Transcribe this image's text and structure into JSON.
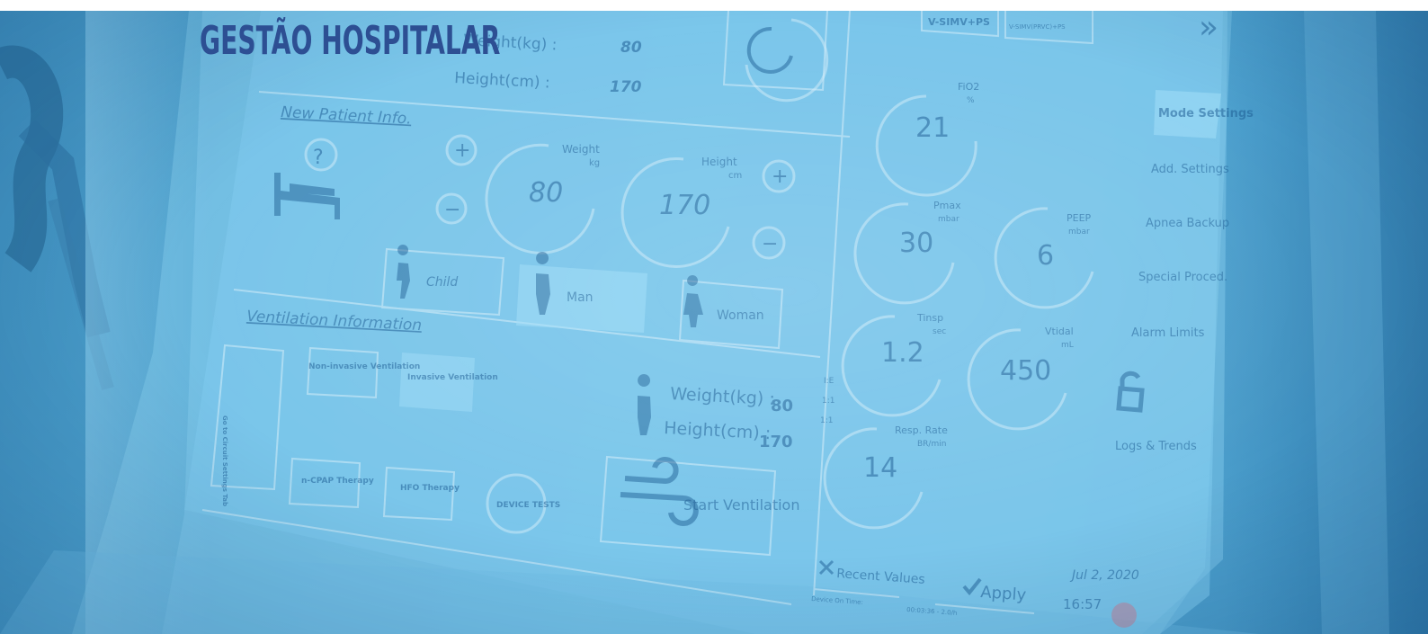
{
  "header": {
    "title": "GESTÃO HOSPITALAR"
  },
  "screen": {
    "top_panel": {
      "weight_label": "Weight(kg) :",
      "weight_value": "80",
      "height_label": "Height(cm) :",
      "height_value": "170"
    },
    "new_patient": {
      "section_title": "New Patient Info.",
      "weight_gauge": {
        "label": "Weight",
        "unit": "kg",
        "value": "80"
      },
      "height_gauge": {
        "label": "Height",
        "unit": "cm",
        "value": "170"
      },
      "plus_symbol": "+",
      "minus_symbol": "−",
      "unknown_symbol": "?",
      "patient_types": [
        "Child",
        "Man",
        "Woman"
      ],
      "selected_patient_type": "Man"
    },
    "ventilation": {
      "section_title": "Ventilation Information",
      "circuit_button": "Go to Circuit Settings Tab",
      "non_invasive": "Non-invasive Ventilation",
      "invasive": "Invasive Ventilation",
      "ncpap": "n-CPAP Therapy",
      "hfo": "HFO Therapy",
      "device_tests": "DEVICE TESTS",
      "summary_weight_label": "Weight(kg) :",
      "summary_weight_value": "80",
      "summary_height_label": "Height(cm) :",
      "summary_height_value": "170",
      "start_label": "Start Ventilation"
    },
    "modes": {
      "mode_a": "V-SIMV+PS",
      "mode_b": "V-SIMV(PRVC)+PS",
      "forward_arrows": "»"
    },
    "gauges": [
      {
        "label": "FiO2",
        "unit": "%",
        "value": "21"
      },
      {
        "label": "Pmax",
        "unit": "mbar",
        "value": "30"
      },
      {
        "label": "PEEP",
        "unit": "mbar",
        "value": "6"
      },
      {
        "label": "Tinsp",
        "unit": "sec",
        "value": "1.2"
      },
      {
        "label": "Vtidal",
        "unit": "mL",
        "value": "450"
      },
      {
        "label": "Resp. Rate",
        "unit": "BR/min",
        "value": "14"
      }
    ],
    "ie_labels": [
      "I:E",
      "1:1",
      "1:1"
    ],
    "side_menu": [
      "Mode Settings",
      "Add. Settings",
      "Apnea Backup",
      "Special Proced.",
      "Alarm Limits",
      "Logs & Trends"
    ],
    "side_menu_active": "Mode Settings",
    "recent_values": "Recent Values",
    "apply": "Apply",
    "date": "Jul 2, 2020",
    "time": "16:57",
    "device_on_time_label": "Device On Time:",
    "device_on_time_value": "00:03:36 - 2.0/h"
  },
  "colors": {
    "title": "#2d4f93",
    "overlay": "#4aa8da",
    "panel_line": "#cfe9f7"
  }
}
